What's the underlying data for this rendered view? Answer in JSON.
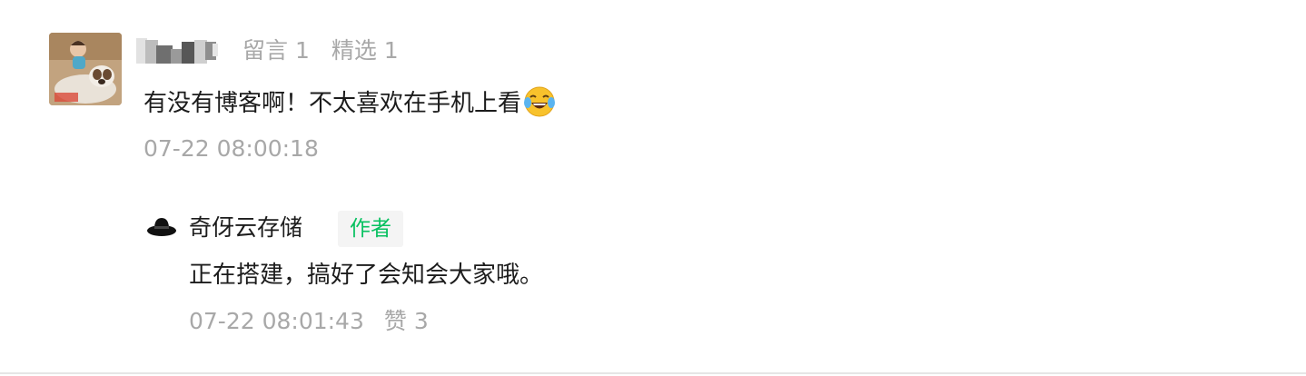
{
  "comment": {
    "stats": {
      "comments_label": "留言 1",
      "featured_label": "精选 1"
    },
    "text": "有没有博客啊！不太喜欢在手机上看",
    "emoji": "face-with-tears-of-joy",
    "time": "07-22 08:00:18"
  },
  "reply": {
    "author": "奇伢云存储",
    "badge": "作者",
    "text": "正在搭建，搞好了会知会大家哦。",
    "time": "07-22 08:01:43",
    "likes_label": "赞 3"
  },
  "colors": {
    "meta_gray": "#a8a8a8",
    "text": "#1c1c1c",
    "author_badge_green": "#07c160",
    "badge_bg": "#f4f4f4"
  }
}
